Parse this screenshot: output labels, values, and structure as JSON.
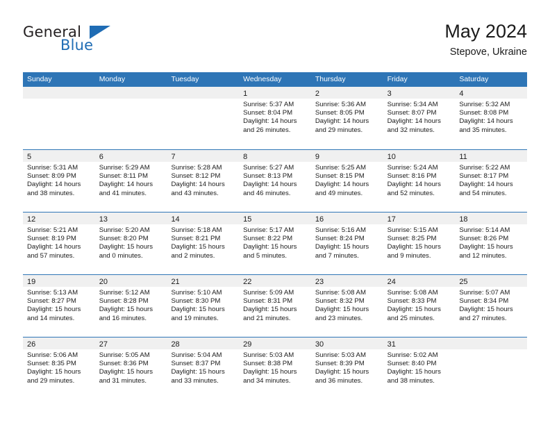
{
  "brand": {
    "name_top": "General",
    "name_bottom": "Blue",
    "accent_color": "#1f6cb4"
  },
  "header": {
    "title": "May 2024",
    "subtitle": "Stepove, Ukraine"
  },
  "theme": {
    "header_row_bg": "#2e75b6",
    "day_band_bg": "#f0f0f0",
    "row_divider": "#2e75b6",
    "text": "#1a1a1a"
  },
  "labels": {
    "sunrise_prefix": "Sunrise:",
    "sunset_prefix": "Sunset:",
    "daylight_prefix": "Daylight:"
  },
  "weekdays": [
    "Sunday",
    "Monday",
    "Tuesday",
    "Wednesday",
    "Thursday",
    "Friday",
    "Saturday"
  ],
  "weeks": [
    [
      {
        "day": "",
        "sunrise": "",
        "sunset": "",
        "daylight_1": "",
        "daylight_2": ""
      },
      {
        "day": "",
        "sunrise": "",
        "sunset": "",
        "daylight_1": "",
        "daylight_2": ""
      },
      {
        "day": "",
        "sunrise": "",
        "sunset": "",
        "daylight_1": "",
        "daylight_2": ""
      },
      {
        "day": "1",
        "sunrise": "Sunrise: 5:37 AM",
        "sunset": "Sunset: 8:04 PM",
        "daylight_1": "Daylight: 14 hours",
        "daylight_2": "and 26 minutes."
      },
      {
        "day": "2",
        "sunrise": "Sunrise: 5:36 AM",
        "sunset": "Sunset: 8:05 PM",
        "daylight_1": "Daylight: 14 hours",
        "daylight_2": "and 29 minutes."
      },
      {
        "day": "3",
        "sunrise": "Sunrise: 5:34 AM",
        "sunset": "Sunset: 8:07 PM",
        "daylight_1": "Daylight: 14 hours",
        "daylight_2": "and 32 minutes."
      },
      {
        "day": "4",
        "sunrise": "Sunrise: 5:32 AM",
        "sunset": "Sunset: 8:08 PM",
        "daylight_1": "Daylight: 14 hours",
        "daylight_2": "and 35 minutes."
      }
    ],
    [
      {
        "day": "5",
        "sunrise": "Sunrise: 5:31 AM",
        "sunset": "Sunset: 8:09 PM",
        "daylight_1": "Daylight: 14 hours",
        "daylight_2": "and 38 minutes."
      },
      {
        "day": "6",
        "sunrise": "Sunrise: 5:29 AM",
        "sunset": "Sunset: 8:11 PM",
        "daylight_1": "Daylight: 14 hours",
        "daylight_2": "and 41 minutes."
      },
      {
        "day": "7",
        "sunrise": "Sunrise: 5:28 AM",
        "sunset": "Sunset: 8:12 PM",
        "daylight_1": "Daylight: 14 hours",
        "daylight_2": "and 43 minutes."
      },
      {
        "day": "8",
        "sunrise": "Sunrise: 5:27 AM",
        "sunset": "Sunset: 8:13 PM",
        "daylight_1": "Daylight: 14 hours",
        "daylight_2": "and 46 minutes."
      },
      {
        "day": "9",
        "sunrise": "Sunrise: 5:25 AM",
        "sunset": "Sunset: 8:15 PM",
        "daylight_1": "Daylight: 14 hours",
        "daylight_2": "and 49 minutes."
      },
      {
        "day": "10",
        "sunrise": "Sunrise: 5:24 AM",
        "sunset": "Sunset: 8:16 PM",
        "daylight_1": "Daylight: 14 hours",
        "daylight_2": "and 52 minutes."
      },
      {
        "day": "11",
        "sunrise": "Sunrise: 5:22 AM",
        "sunset": "Sunset: 8:17 PM",
        "daylight_1": "Daylight: 14 hours",
        "daylight_2": "and 54 minutes."
      }
    ],
    [
      {
        "day": "12",
        "sunrise": "Sunrise: 5:21 AM",
        "sunset": "Sunset: 8:19 PM",
        "daylight_1": "Daylight: 14 hours",
        "daylight_2": "and 57 minutes."
      },
      {
        "day": "13",
        "sunrise": "Sunrise: 5:20 AM",
        "sunset": "Sunset: 8:20 PM",
        "daylight_1": "Daylight: 15 hours",
        "daylight_2": "and 0 minutes."
      },
      {
        "day": "14",
        "sunrise": "Sunrise: 5:18 AM",
        "sunset": "Sunset: 8:21 PM",
        "daylight_1": "Daylight: 15 hours",
        "daylight_2": "and 2 minutes."
      },
      {
        "day": "15",
        "sunrise": "Sunrise: 5:17 AM",
        "sunset": "Sunset: 8:22 PM",
        "daylight_1": "Daylight: 15 hours",
        "daylight_2": "and 5 minutes."
      },
      {
        "day": "16",
        "sunrise": "Sunrise: 5:16 AM",
        "sunset": "Sunset: 8:24 PM",
        "daylight_1": "Daylight: 15 hours",
        "daylight_2": "and 7 minutes."
      },
      {
        "day": "17",
        "sunrise": "Sunrise: 5:15 AM",
        "sunset": "Sunset: 8:25 PM",
        "daylight_1": "Daylight: 15 hours",
        "daylight_2": "and 9 minutes."
      },
      {
        "day": "18",
        "sunrise": "Sunrise: 5:14 AM",
        "sunset": "Sunset: 8:26 PM",
        "daylight_1": "Daylight: 15 hours",
        "daylight_2": "and 12 minutes."
      }
    ],
    [
      {
        "day": "19",
        "sunrise": "Sunrise: 5:13 AM",
        "sunset": "Sunset: 8:27 PM",
        "daylight_1": "Daylight: 15 hours",
        "daylight_2": "and 14 minutes."
      },
      {
        "day": "20",
        "sunrise": "Sunrise: 5:12 AM",
        "sunset": "Sunset: 8:28 PM",
        "daylight_1": "Daylight: 15 hours",
        "daylight_2": "and 16 minutes."
      },
      {
        "day": "21",
        "sunrise": "Sunrise: 5:10 AM",
        "sunset": "Sunset: 8:30 PM",
        "daylight_1": "Daylight: 15 hours",
        "daylight_2": "and 19 minutes."
      },
      {
        "day": "22",
        "sunrise": "Sunrise: 5:09 AM",
        "sunset": "Sunset: 8:31 PM",
        "daylight_1": "Daylight: 15 hours",
        "daylight_2": "and 21 minutes."
      },
      {
        "day": "23",
        "sunrise": "Sunrise: 5:08 AM",
        "sunset": "Sunset: 8:32 PM",
        "daylight_1": "Daylight: 15 hours",
        "daylight_2": "and 23 minutes."
      },
      {
        "day": "24",
        "sunrise": "Sunrise: 5:08 AM",
        "sunset": "Sunset: 8:33 PM",
        "daylight_1": "Daylight: 15 hours",
        "daylight_2": "and 25 minutes."
      },
      {
        "day": "25",
        "sunrise": "Sunrise: 5:07 AM",
        "sunset": "Sunset: 8:34 PM",
        "daylight_1": "Daylight: 15 hours",
        "daylight_2": "and 27 minutes."
      }
    ],
    [
      {
        "day": "26",
        "sunrise": "Sunrise: 5:06 AM",
        "sunset": "Sunset: 8:35 PM",
        "daylight_1": "Daylight: 15 hours",
        "daylight_2": "and 29 minutes."
      },
      {
        "day": "27",
        "sunrise": "Sunrise: 5:05 AM",
        "sunset": "Sunset: 8:36 PM",
        "daylight_1": "Daylight: 15 hours",
        "daylight_2": "and 31 minutes."
      },
      {
        "day": "28",
        "sunrise": "Sunrise: 5:04 AM",
        "sunset": "Sunset: 8:37 PM",
        "daylight_1": "Daylight: 15 hours",
        "daylight_2": "and 33 minutes."
      },
      {
        "day": "29",
        "sunrise": "Sunrise: 5:03 AM",
        "sunset": "Sunset: 8:38 PM",
        "daylight_1": "Daylight: 15 hours",
        "daylight_2": "and 34 minutes."
      },
      {
        "day": "30",
        "sunrise": "Sunrise: 5:03 AM",
        "sunset": "Sunset: 8:39 PM",
        "daylight_1": "Daylight: 15 hours",
        "daylight_2": "and 36 minutes."
      },
      {
        "day": "31",
        "sunrise": "Sunrise: 5:02 AM",
        "sunset": "Sunset: 8:40 PM",
        "daylight_1": "Daylight: 15 hours",
        "daylight_2": "and 38 minutes."
      },
      {
        "day": "",
        "sunrise": "",
        "sunset": "",
        "daylight_1": "",
        "daylight_2": ""
      }
    ]
  ]
}
